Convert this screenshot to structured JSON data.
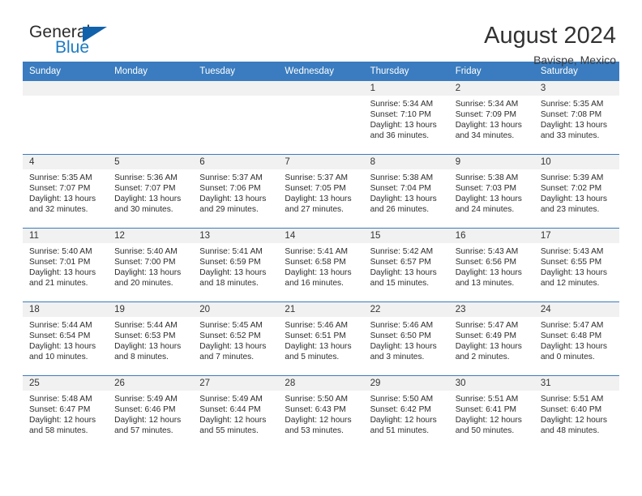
{
  "brand": {
    "name_part1": "General",
    "name_part2": "Blue",
    "triangle_color": "#1162ab",
    "blue_color": "#1c7cc4"
  },
  "header": {
    "title": "August 2024",
    "subtitle": "Bavispe, Mexico"
  },
  "theme": {
    "header_bg": "#3a7cbf",
    "daynum_bg": "#f1f1f1",
    "row_border": "#3a7cbf"
  },
  "weekdays": [
    "Sunday",
    "Monday",
    "Tuesday",
    "Wednesday",
    "Thursday",
    "Friday",
    "Saturday"
  ],
  "weeks": [
    [
      {
        "day": "",
        "empty": true,
        "sunrise": "",
        "sunset": "",
        "daylight": ""
      },
      {
        "day": "",
        "empty": true,
        "sunrise": "",
        "sunset": "",
        "daylight": ""
      },
      {
        "day": "",
        "empty": true,
        "sunrise": "",
        "sunset": "",
        "daylight": ""
      },
      {
        "day": "",
        "empty": true,
        "sunrise": "",
        "sunset": "",
        "daylight": ""
      },
      {
        "day": "1",
        "empty": false,
        "sunrise": "Sunrise: 5:34 AM",
        "sunset": "Sunset: 7:10 PM",
        "daylight": "Daylight: 13 hours and 36 minutes."
      },
      {
        "day": "2",
        "empty": false,
        "sunrise": "Sunrise: 5:34 AM",
        "sunset": "Sunset: 7:09 PM",
        "daylight": "Daylight: 13 hours and 34 minutes."
      },
      {
        "day": "3",
        "empty": false,
        "sunrise": "Sunrise: 5:35 AM",
        "sunset": "Sunset: 7:08 PM",
        "daylight": "Daylight: 13 hours and 33 minutes."
      }
    ],
    [
      {
        "day": "4",
        "empty": false,
        "sunrise": "Sunrise: 5:35 AM",
        "sunset": "Sunset: 7:07 PM",
        "daylight": "Daylight: 13 hours and 32 minutes."
      },
      {
        "day": "5",
        "empty": false,
        "sunrise": "Sunrise: 5:36 AM",
        "sunset": "Sunset: 7:07 PM",
        "daylight": "Daylight: 13 hours and 30 minutes."
      },
      {
        "day": "6",
        "empty": false,
        "sunrise": "Sunrise: 5:37 AM",
        "sunset": "Sunset: 7:06 PM",
        "daylight": "Daylight: 13 hours and 29 minutes."
      },
      {
        "day": "7",
        "empty": false,
        "sunrise": "Sunrise: 5:37 AM",
        "sunset": "Sunset: 7:05 PM",
        "daylight": "Daylight: 13 hours and 27 minutes."
      },
      {
        "day": "8",
        "empty": false,
        "sunrise": "Sunrise: 5:38 AM",
        "sunset": "Sunset: 7:04 PM",
        "daylight": "Daylight: 13 hours and 26 minutes."
      },
      {
        "day": "9",
        "empty": false,
        "sunrise": "Sunrise: 5:38 AM",
        "sunset": "Sunset: 7:03 PM",
        "daylight": "Daylight: 13 hours and 24 minutes."
      },
      {
        "day": "10",
        "empty": false,
        "sunrise": "Sunrise: 5:39 AM",
        "sunset": "Sunset: 7:02 PM",
        "daylight": "Daylight: 13 hours and 23 minutes."
      }
    ],
    [
      {
        "day": "11",
        "empty": false,
        "sunrise": "Sunrise: 5:40 AM",
        "sunset": "Sunset: 7:01 PM",
        "daylight": "Daylight: 13 hours and 21 minutes."
      },
      {
        "day": "12",
        "empty": false,
        "sunrise": "Sunrise: 5:40 AM",
        "sunset": "Sunset: 7:00 PM",
        "daylight": "Daylight: 13 hours and 20 minutes."
      },
      {
        "day": "13",
        "empty": false,
        "sunrise": "Sunrise: 5:41 AM",
        "sunset": "Sunset: 6:59 PM",
        "daylight": "Daylight: 13 hours and 18 minutes."
      },
      {
        "day": "14",
        "empty": false,
        "sunrise": "Sunrise: 5:41 AM",
        "sunset": "Sunset: 6:58 PM",
        "daylight": "Daylight: 13 hours and 16 minutes."
      },
      {
        "day": "15",
        "empty": false,
        "sunrise": "Sunrise: 5:42 AM",
        "sunset": "Sunset: 6:57 PM",
        "daylight": "Daylight: 13 hours and 15 minutes."
      },
      {
        "day": "16",
        "empty": false,
        "sunrise": "Sunrise: 5:43 AM",
        "sunset": "Sunset: 6:56 PM",
        "daylight": "Daylight: 13 hours and 13 minutes."
      },
      {
        "day": "17",
        "empty": false,
        "sunrise": "Sunrise: 5:43 AM",
        "sunset": "Sunset: 6:55 PM",
        "daylight": "Daylight: 13 hours and 12 minutes."
      }
    ],
    [
      {
        "day": "18",
        "empty": false,
        "sunrise": "Sunrise: 5:44 AM",
        "sunset": "Sunset: 6:54 PM",
        "daylight": "Daylight: 13 hours and 10 minutes."
      },
      {
        "day": "19",
        "empty": false,
        "sunrise": "Sunrise: 5:44 AM",
        "sunset": "Sunset: 6:53 PM",
        "daylight": "Daylight: 13 hours and 8 minutes."
      },
      {
        "day": "20",
        "empty": false,
        "sunrise": "Sunrise: 5:45 AM",
        "sunset": "Sunset: 6:52 PM",
        "daylight": "Daylight: 13 hours and 7 minutes."
      },
      {
        "day": "21",
        "empty": false,
        "sunrise": "Sunrise: 5:46 AM",
        "sunset": "Sunset: 6:51 PM",
        "daylight": "Daylight: 13 hours and 5 minutes."
      },
      {
        "day": "22",
        "empty": false,
        "sunrise": "Sunrise: 5:46 AM",
        "sunset": "Sunset: 6:50 PM",
        "daylight": "Daylight: 13 hours and 3 minutes."
      },
      {
        "day": "23",
        "empty": false,
        "sunrise": "Sunrise: 5:47 AM",
        "sunset": "Sunset: 6:49 PM",
        "daylight": "Daylight: 13 hours and 2 minutes."
      },
      {
        "day": "24",
        "empty": false,
        "sunrise": "Sunrise: 5:47 AM",
        "sunset": "Sunset: 6:48 PM",
        "daylight": "Daylight: 13 hours and 0 minutes."
      }
    ],
    [
      {
        "day": "25",
        "empty": false,
        "sunrise": "Sunrise: 5:48 AM",
        "sunset": "Sunset: 6:47 PM",
        "daylight": "Daylight: 12 hours and 58 minutes."
      },
      {
        "day": "26",
        "empty": false,
        "sunrise": "Sunrise: 5:49 AM",
        "sunset": "Sunset: 6:46 PM",
        "daylight": "Daylight: 12 hours and 57 minutes."
      },
      {
        "day": "27",
        "empty": false,
        "sunrise": "Sunrise: 5:49 AM",
        "sunset": "Sunset: 6:44 PM",
        "daylight": "Daylight: 12 hours and 55 minutes."
      },
      {
        "day": "28",
        "empty": false,
        "sunrise": "Sunrise: 5:50 AM",
        "sunset": "Sunset: 6:43 PM",
        "daylight": "Daylight: 12 hours and 53 minutes."
      },
      {
        "day": "29",
        "empty": false,
        "sunrise": "Sunrise: 5:50 AM",
        "sunset": "Sunset: 6:42 PM",
        "daylight": "Daylight: 12 hours and 51 minutes."
      },
      {
        "day": "30",
        "empty": false,
        "sunrise": "Sunrise: 5:51 AM",
        "sunset": "Sunset: 6:41 PM",
        "daylight": "Daylight: 12 hours and 50 minutes."
      },
      {
        "day": "31",
        "empty": false,
        "sunrise": "Sunrise: 5:51 AM",
        "sunset": "Sunset: 6:40 PM",
        "daylight": "Daylight: 12 hours and 48 minutes."
      }
    ]
  ]
}
